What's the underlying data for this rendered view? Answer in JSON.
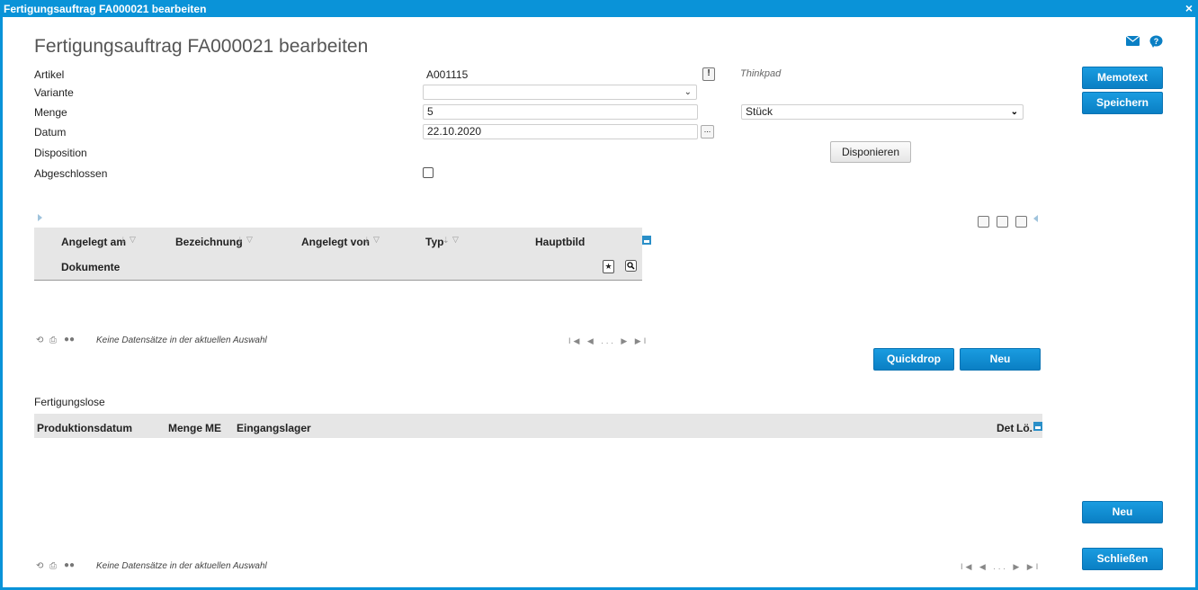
{
  "window": {
    "title": "Fertigungsauftrag FA000021 bearbeiten",
    "close_glyph": "×"
  },
  "page": {
    "title": "Fertigungsauftrag FA000021 bearbeiten"
  },
  "form": {
    "artikel": {
      "label": "Artikel",
      "value": "A001115",
      "info_glyph": "!",
      "description": "Thinkpad"
    },
    "variante": {
      "label": "Variante",
      "value": ""
    },
    "menge": {
      "label": "Menge",
      "value": "5",
      "unit": "Stück"
    },
    "datum": {
      "label": "Datum",
      "value": "22.10.2020",
      "picker_glyph": "..."
    },
    "disposition": {
      "label": "Disposition",
      "button": "Disponieren"
    },
    "abgeschlossen": {
      "label": "Abgeschlossen",
      "checked": false
    }
  },
  "side_buttons": {
    "memotext": "Memotext",
    "speichern": "Speichern",
    "neu": "Neu",
    "schliessen": "Schließen"
  },
  "documents_grid": {
    "columns": [
      "Angelegt am",
      "Bezeichnung",
      "Angelegt von",
      "Typ",
      "Hauptbild"
    ],
    "second_row": "Dokumente",
    "status": "Keine Datensätze in der aktuellen Auswahl",
    "pager": "I◀ ◀ ... ▶ ▶I",
    "buttons": {
      "quickdrop": "Quickdrop",
      "neu": "Neu"
    }
  },
  "lots": {
    "section_label": "Fertigungslose",
    "columns": [
      "Produktionsdatum",
      "Menge",
      "ME",
      "Eingangslager"
    ],
    "right_columns": [
      "Det",
      "Lö."
    ],
    "status": "Keine Datensätze in der aktuellen Auswahl",
    "pager": "I◀ ◀ ... ▶ ▶I"
  },
  "icons": [
    "mail-icon",
    "help-icon",
    "filter-icon",
    "sort-icon",
    "star-icon",
    "search-icon",
    "refresh-icon",
    "print-icon",
    "dots-icon",
    "column-chooser-icon",
    "layout-icon"
  ],
  "colors": {
    "accent": "#0a93d8",
    "button_blue": "#0a7fc4",
    "grid_header": "#e6e6e6"
  }
}
